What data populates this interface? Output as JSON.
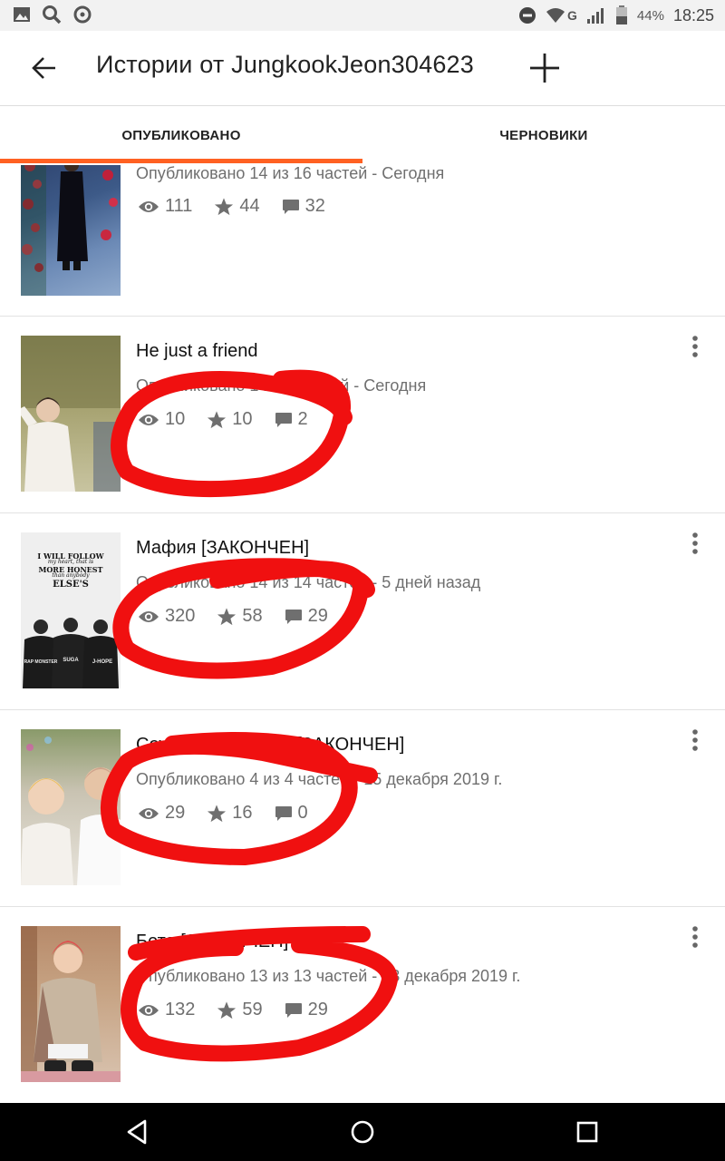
{
  "status_bar": {
    "battery": "44%",
    "time": "18:25",
    "network": "G"
  },
  "app_bar": {
    "title": "Истории от JungkookJeon304623"
  },
  "tabs": [
    {
      "label": "ОПУБЛИКОВАНО",
      "selected": true
    },
    {
      "label": "ЧЕРНОВИКИ",
      "selected": false
    }
  ],
  "accent_color": "#ff6122",
  "stories": [
    {
      "title": "",
      "meta": "Опубликовано 14 из 16 частей - Сегодня",
      "views": "111",
      "votes": "44",
      "comments": "32"
    },
    {
      "title": "He just a friend",
      "meta": "Опубликовано 1 из 3 частей - Сегодня",
      "views": "10",
      "votes": "10",
      "comments": "2"
    },
    {
      "title": "Мафия [ЗАКОНЧЕН]",
      "meta": "Опубликовано 14 из 14 частей - 5 дней назад",
      "views": "320",
      "votes": "58",
      "comments": "29",
      "cover_text": [
        "I WILL FOLLOW",
        "my heart, that is",
        "MORE HONEST",
        "than anybody",
        "ELSE'S",
        "RAP MONSTER",
        "SUGA",
        "J-HOPE"
      ]
    },
    {
      "title": "Соулмейт история [ЗАКОНЧЕН]",
      "meta": "Опубликовано 4 из 4 частей - 15 декабря 2019 г.",
      "views": "29",
      "votes": "16",
      "comments": "0"
    },
    {
      "title": "Бета [ЗАКОНЧЕН]",
      "meta": "Опубликовано 13 из 13 частей - 13 декабря 2019 г.",
      "views": "132",
      "votes": "59",
      "comments": "29"
    }
  ],
  "annotation_color": "#f01010"
}
